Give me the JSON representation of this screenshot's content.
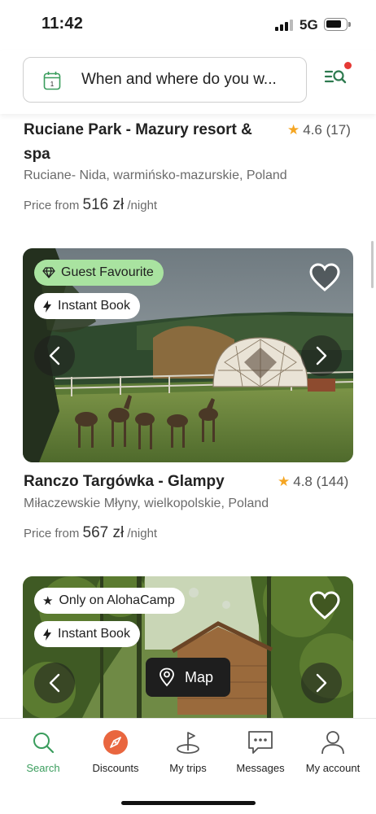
{
  "status": {
    "time": "11:42",
    "network": "5G"
  },
  "search": {
    "placeholder_text": "When and where do you w..."
  },
  "listings": [
    {
      "title_line1": "Ruciane Park - Mazury resort &",
      "title_line2": "spa",
      "rating": "4.6",
      "reviews": "(17)",
      "location": "Ruciane- Nida, warmińsko-mazurskie, Poland",
      "price_prefix": "Price from",
      "price": "516 zł",
      "price_suffix": "/night"
    },
    {
      "badge_primary": "Guest Favourite",
      "badge_secondary": "Instant Book",
      "title": "Ranczo Targówka - Glampy",
      "rating": "4.8",
      "reviews": "(144)",
      "location": "Miłaczewskie Młyny, wielkopolskie, Poland",
      "price_prefix": "Price from",
      "price": "567 zł",
      "price_suffix": "/night"
    },
    {
      "badge_primary": "Only on AlohaCamp",
      "badge_secondary": "Instant Book"
    }
  ],
  "map_button": {
    "label": "Map"
  },
  "nav": [
    {
      "label": "Search",
      "icon": "search-icon",
      "active": true
    },
    {
      "label": "Discounts",
      "icon": "compass-icon"
    },
    {
      "label": "My trips",
      "icon": "trips-icon"
    },
    {
      "label": "Messages",
      "icon": "messages-icon"
    },
    {
      "label": "My account",
      "icon": "account-icon"
    }
  ],
  "colors": {
    "accent_green": "#3a9d5d",
    "badge_green": "#a9e3a0",
    "star": "#f5a623",
    "notification_dot": "#e53935",
    "discount_orange": "#e9663f"
  }
}
